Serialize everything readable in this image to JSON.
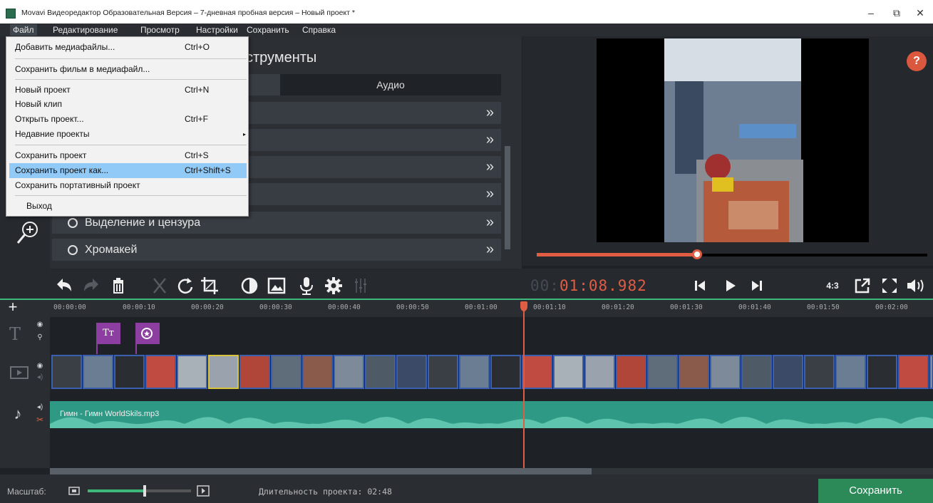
{
  "window": {
    "title": "Movavi Видеоредактор Образовательная Версия – 7-дневная пробная версия – Новый проект *",
    "controls": [
      "–",
      "⧉",
      "✕"
    ]
  },
  "menubar": [
    "Файл",
    "Редактирование",
    "Просмотр",
    "Настройки",
    "Сохранить",
    "Справка"
  ],
  "file_menu": {
    "items": [
      {
        "label": "Добавить медиафайлы...",
        "shortcut": "Ctrl+O"
      },
      {
        "label": "Сохранить фильм в медиафайл...",
        "shortcut": ""
      },
      {
        "label": "Новый проект",
        "shortcut": "Ctrl+N"
      },
      {
        "label": "Новый клип",
        "shortcut": ""
      },
      {
        "label": "Открыть проект...",
        "shortcut": "Ctrl+F"
      },
      {
        "label": "Недавние проекты",
        "shortcut": "▸"
      },
      {
        "label": "Сохранить проект",
        "shortcut": "Ctrl+S"
      },
      {
        "label": "Сохранить проект как...",
        "shortcut": "Ctrl+Shift+S"
      },
      {
        "label": "Сохранить портативный проект",
        "shortcut": ""
      },
      {
        "label": "Выход",
        "shortcut": ""
      }
    ],
    "highlighted": "Сохранить проект как..."
  },
  "tools": {
    "title_fragment": "струменты",
    "tabs": [
      "Аудио"
    ],
    "rows": [
      "Выделение и цензура",
      "Хромакей"
    ]
  },
  "preview": {
    "help": "?",
    "seek_progress": 0.41
  },
  "toolbar": {
    "timecode_prefix": "00:",
    "timecode_main": "01:08.982",
    "aspect": "4:3"
  },
  "timeline": {
    "ticks": [
      "00:00:00",
      "00:00:10",
      "00:00:20",
      "00:00:30",
      "00:00:40",
      "00:00:50",
      "00:01:00",
      "00:01:10",
      "00:01:20",
      "00:01:30",
      "00:01:40",
      "00:01:50",
      "00:02:00"
    ],
    "title_clip_icon": "Tт",
    "audio_clip": "Гимн - Гимн  WorldSkils.mp3"
  },
  "statusbar": {
    "scale_label": "Масштаб:",
    "zoom_level": 0.55,
    "duration": "Длительность проекта: 02:48",
    "save_button": "Сохранить"
  },
  "colors": {
    "accent_red": "#e05d44",
    "accent_green": "#3db87a",
    "save_green": "#2b8a57",
    "audio_teal": "#2e9a86",
    "clip_purple": "#8c3fa0",
    "menu_highlight": "#91c9f7"
  }
}
